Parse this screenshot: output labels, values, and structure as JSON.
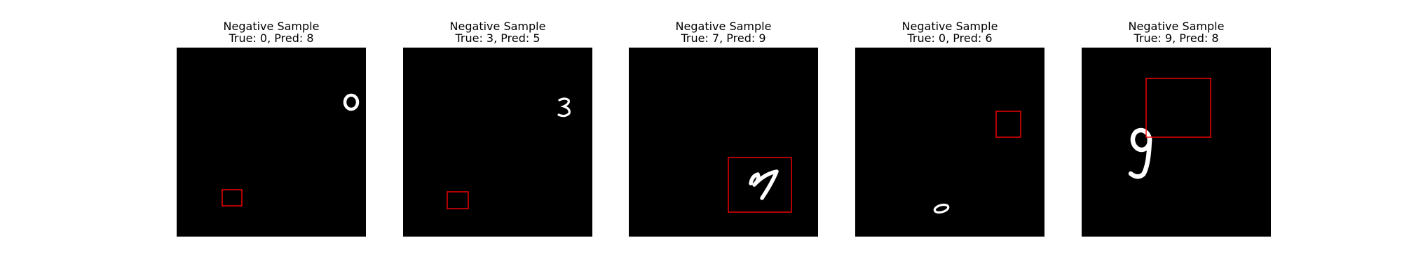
{
  "panels": [
    {
      "title": "Negative Sample",
      "label": "True: 0, Pred: 8",
      "digit_icon": "digit-0-icon",
      "box_color": "#ff0000"
    },
    {
      "title": "Negative Sample",
      "label": "True: 3, Pred: 5",
      "digit_icon": "digit-3-icon",
      "box_color": "#ff0000"
    },
    {
      "title": "Negative Sample",
      "label": "True: 7, Pred: 9",
      "digit_icon": "digit-7-icon",
      "box_color": "#ff0000"
    },
    {
      "title": "Negative Sample",
      "label": "True: 0, Pred: 6",
      "digit_icon": "digit-0-icon",
      "box_color": "#ff0000"
    },
    {
      "title": "Negative Sample",
      "label": "True: 9, Pred: 8",
      "digit_icon": "digit-9-icon",
      "box_color": "#ff0000"
    }
  ]
}
